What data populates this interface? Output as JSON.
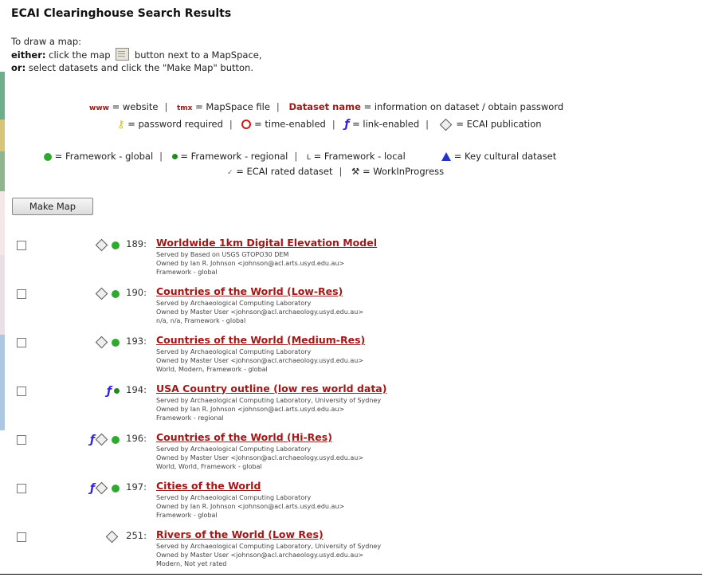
{
  "page": {
    "title": "ECAI Clearinghouse Search Results"
  },
  "intro": {
    "heading": "To draw a map:",
    "either_label": "either:",
    "either_text_before": "click the map",
    "either_text_after": "button next to a MapSpace,",
    "or_label": "or:",
    "or_text": "select datasets and click the \"Make Map\" button."
  },
  "legend": {
    "www_abbr": "www",
    "website": "= website",
    "tmx_abbr": "tmx",
    "mapspace": "= MapSpace file",
    "dataset_name": "Dataset name",
    "dataset_info": "= information on dataset / obtain password",
    "password": "= password required",
    "time": "= time-enabled",
    "link": "= link-enabled",
    "publication": "= ECAI publication",
    "fw_global": "= Framework - global",
    "fw_regional": "= Framework - regional",
    "fw_local_abbr": "L",
    "fw_local": "= Framework - local",
    "key_cultural": "= Key cultural dataset",
    "rated_abbr": "✓",
    "rated": "= ECAI rated dataset",
    "wip": "= WorkInProgress"
  },
  "sep": "|",
  "make_map_label": "Make Map",
  "rows": [
    {
      "num": "189:",
      "title": "Worldwide 1km Digital Elevation Model",
      "lines": [
        "Served by Based on USGS GTOPO30 DEM",
        "Owned by Ian R. Johnson <johnson@acl.arts.usyd.edu.au>",
        "Framework - global"
      ],
      "link": false,
      "pub": true,
      "dot": "global"
    },
    {
      "num": "190:",
      "title": "Countries of the World (Low-Res)",
      "lines": [
        "Served by Archaeological Computing Laboratory",
        "Owned by Master User <johnson@acl.archaeology.usyd.edu.au>",
        "n/a, n/a, Framework - global"
      ],
      "link": false,
      "pub": true,
      "dot": "global"
    },
    {
      "num": "193:",
      "title": "Countries of the World (Medium-Res)",
      "lines": [
        "Served by Archaeological Computing Laboratory",
        "Owned by Master User <johnson@acl.archaeology.usyd.edu.au>",
        "World, Modern, Framework - global"
      ],
      "link": false,
      "pub": true,
      "dot": "global"
    },
    {
      "num": "194:",
      "title": "USA Country outline (low res world data)",
      "lines": [
        "Served by Archaeological Computing Laboratory, University of Sydney",
        "Owned by Ian R. Johnson <johnson@acl.arts.usyd.edu.au>",
        "Framework - regional"
      ],
      "link": true,
      "pub": false,
      "dot": "regional"
    },
    {
      "num": "196:",
      "title": "Countries of the World (Hi-Res)",
      "lines": [
        "Served by Archaeological Computing Laboratory",
        "Owned by Master User <johnson@acl.archaeology.usyd.edu.au>",
        "World, World, Framework - global"
      ],
      "link": true,
      "pub": true,
      "dot": "global"
    },
    {
      "num": "197:",
      "title": "Cities of the World",
      "lines": [
        "Served by Archaeological Computing Laboratory",
        "Owned by Ian R. Johnson <johnson@acl.arts.usyd.edu.au>",
        "Framework - global"
      ],
      "link": true,
      "pub": true,
      "dot": "global"
    },
    {
      "num": "251:",
      "title": "Rivers of the World (Low Res)",
      "lines": [
        "Served by Archaeological Computing Laboratory, University of Sydney",
        "Owned by Master User <johnson@acl.archaeology.usyd.edu.au>",
        "Modern, Not yet rated"
      ],
      "link": false,
      "pub": true,
      "dot": "none"
    }
  ],
  "colors": {
    "accent": "#a01818",
    "global_dot": "#2eaa2e",
    "key_triangle": "#2233cc"
  }
}
